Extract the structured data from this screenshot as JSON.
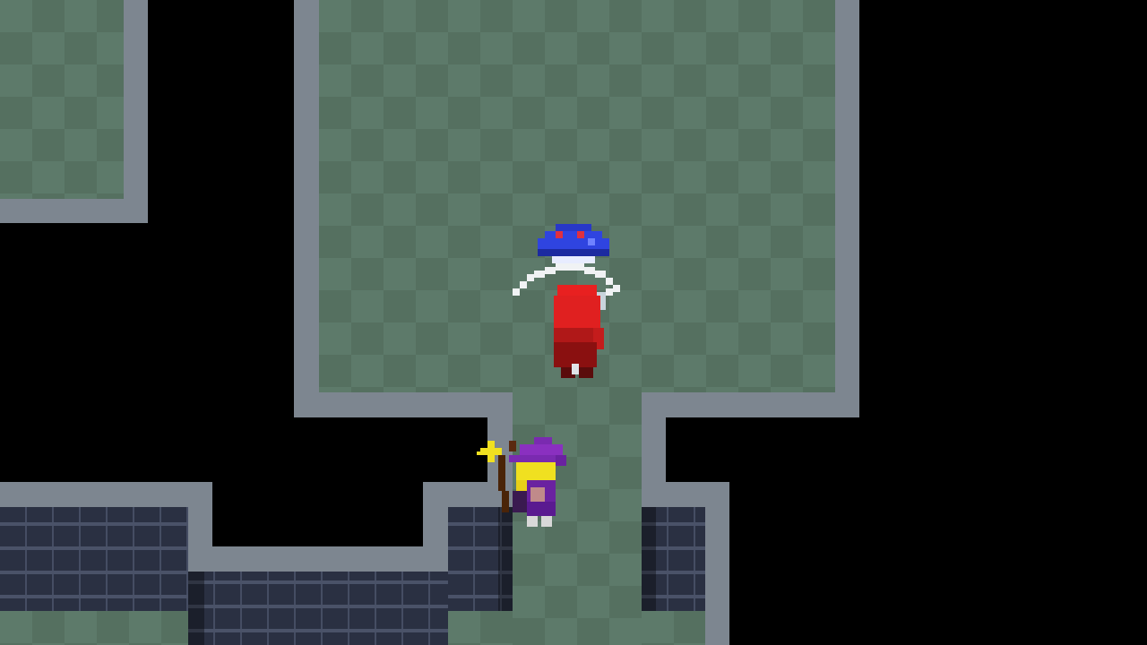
{
  "scene": {
    "type": "top-down pixel dungeon",
    "palette": {
      "floor": "#5d7a6a",
      "floor_alt": "#557060",
      "wall": "#7d8690",
      "brick": "#2a3042",
      "void": "#000000"
    }
  },
  "entities": {
    "player": {
      "name": "red-knight",
      "icon": "knight-sprite",
      "facing": "up",
      "action": "sword-slash"
    },
    "enemy": {
      "name": "blue-slime",
      "icon": "slime-sprite"
    },
    "npc": {
      "name": "purple-wizard",
      "icon": "wizard-sprite",
      "item": "star-staff"
    }
  }
}
